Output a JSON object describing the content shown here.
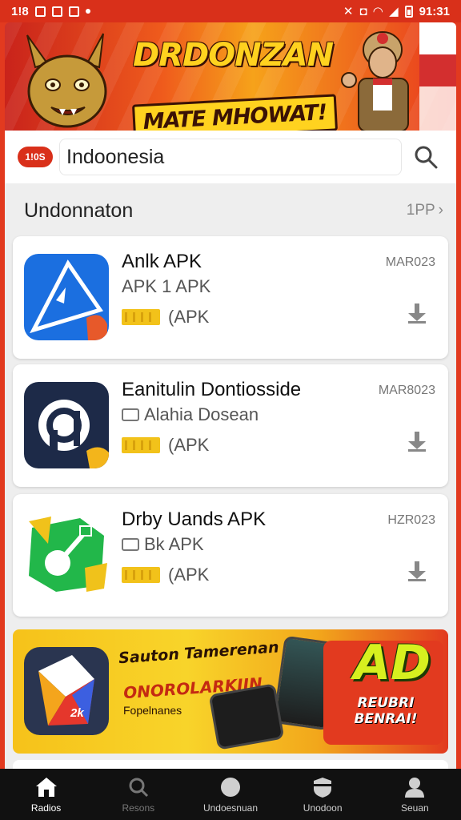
{
  "status_bar": {
    "left_text": "1!8",
    "right_text": "91:31"
  },
  "banner": {
    "title": "DRDONZAN",
    "subtitle": "MATE MHOWAT!"
  },
  "search": {
    "logo_text": "1!0S",
    "value": "Indoonesia",
    "search_icon": "search-icon"
  },
  "section": {
    "title": "Undonnaton",
    "more_label": "1PP"
  },
  "apps": [
    {
      "name": "Anlk APK",
      "developer": "APK 1 APK",
      "type": "(APK",
      "date": "MAR023",
      "icon": "triangle-app-icon",
      "colors": {
        "primary": "#1b6fe0",
        "accent": "#e7592a"
      }
    },
    {
      "name": "Eanitulin Dontiosside",
      "developer": "Alahia Dosean",
      "type": "(APK",
      "date": "MAR8023",
      "icon": "letter-a-app-icon",
      "colors": {
        "primary": "#1d2a48",
        "accent": "#f3b51b"
      }
    },
    {
      "name": "Drby Uands APK",
      "developer": "Bk APK",
      "type": "(APK",
      "date": "HZR023",
      "icon": "guitar-app-icon",
      "colors": {
        "primary": "#22b74a",
        "accent": "#f0c21b"
      }
    }
  ],
  "promo": {
    "headline": "Sauton Tamerenan",
    "line2": "ONOROLARKIIN",
    "tag": "Fopelnanes",
    "badge_big": "AD",
    "badge_text": "REUBRI BENRAI!",
    "icon_text": "2k"
  },
  "nav": [
    {
      "label": "Radios",
      "icon": "home-icon",
      "active": true
    },
    {
      "label": "Resons",
      "icon": "search-icon",
      "muted": true
    },
    {
      "label": "Undoesnuan",
      "icon": "circle-icon"
    },
    {
      "label": "Unodoon",
      "icon": "shield-icon"
    },
    {
      "label": "Seuan",
      "icon": "profile-icon"
    }
  ],
  "theme": {
    "brand_red": "#e23a1f",
    "rating_yellow": "#f2c21a",
    "nav_bg": "#111111"
  }
}
